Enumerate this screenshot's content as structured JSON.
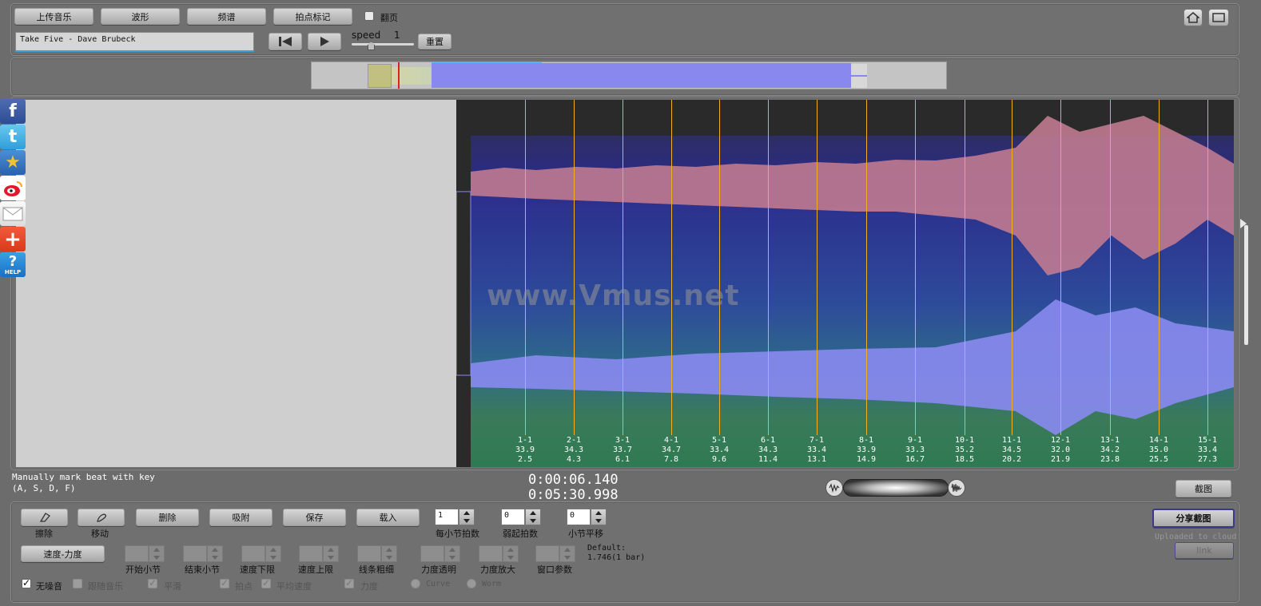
{
  "toolbar": {
    "upload_label": "上传音乐",
    "waveform_label": "波形",
    "spectrum_label": "频谱",
    "beat_mark_label": "拍点标记",
    "page_turn_label": "翻页",
    "track_title": "Take Five - Dave Brubeck",
    "speed_label": "speed",
    "speed_value": "1",
    "reset_label": "重置"
  },
  "social": [
    "facebook-icon",
    "twitter-icon",
    "favorite-icon",
    "weibo-icon",
    "mail-icon",
    "add-icon",
    "help-icon"
  ],
  "social_help_text": "HELP",
  "watermark": "www.Vmus.net",
  "beats": [
    {
      "bar": "1-1",
      "tempo": "33.9",
      "time": "2.5"
    },
    {
      "bar": "2-1",
      "tempo": "34.3",
      "time": "4.3"
    },
    {
      "bar": "3-1",
      "tempo": "33.7",
      "time": "6.1"
    },
    {
      "bar": "4-1",
      "tempo": "34.7",
      "time": "7.8"
    },
    {
      "bar": "5-1",
      "tempo": "33.4",
      "time": "9.6"
    },
    {
      "bar": "6-1",
      "tempo": "34.3",
      "time": "11.4"
    },
    {
      "bar": "7-1",
      "tempo": "33.4",
      "time": "13.1"
    },
    {
      "bar": "8-1",
      "tempo": "33.9",
      "time": "14.9"
    },
    {
      "bar": "9-1",
      "tempo": "33.3",
      "time": "16.7"
    },
    {
      "bar": "10-1",
      "tempo": "35.2",
      "time": "18.5"
    },
    {
      "bar": "11-1",
      "tempo": "34.5",
      "time": "20.2"
    },
    {
      "bar": "12-1",
      "tempo": "32.0",
      "time": "21.9"
    },
    {
      "bar": "13-1",
      "tempo": "34.2",
      "time": "23.8"
    },
    {
      "bar": "14-1",
      "tempo": "35.0",
      "time": "25.5"
    },
    {
      "bar": "15-1",
      "tempo": "33.4",
      "time": "27.3"
    }
  ],
  "status": {
    "hint_line1": "Manually mark beat with key",
    "hint_line2": "(A, S, D, F)",
    "current_time": "0:00:06.140",
    "total_time": "0:05:30.998",
    "screenshot_label": "截图"
  },
  "controls": {
    "erase_label": "擦除",
    "move_label": "移动",
    "delete_label": "删除",
    "snap_label": "吸附",
    "save_label": "保存",
    "load_label": "载入",
    "beats_per_bar_label": "每小节拍数",
    "beats_per_bar_value": "1",
    "pickup_label": "弱起拍数",
    "pickup_value": "0",
    "bar_shift_label": "小节平移",
    "bar_shift_value": "0",
    "tempo_dynamics_label": "速度-力度",
    "start_bar_label": "开始小节",
    "end_bar_label": "结束小节",
    "tempo_min_label": "速度下限",
    "tempo_max_label": "速度上限",
    "line_width_label": "线条粗细",
    "dyn_transparency_label": "力度透明",
    "dyn_zoom_label": "力度放大",
    "window_param_label": "窗口参数",
    "default_line1": "Default:",
    "default_line2": "1.746(1 bar)",
    "mute_label": "无噪音",
    "follow_music_label": "跟随音乐",
    "smooth_label": "平滑",
    "beat_point_label": "拍点",
    "avg_tempo_label": "平均速度",
    "dynamics_label": "力度",
    "curve_label": "Curve",
    "worm_label": "Worm",
    "share_label": "分享截图",
    "uploaded_label": "Uploaded to cloud",
    "link_label": "link"
  }
}
